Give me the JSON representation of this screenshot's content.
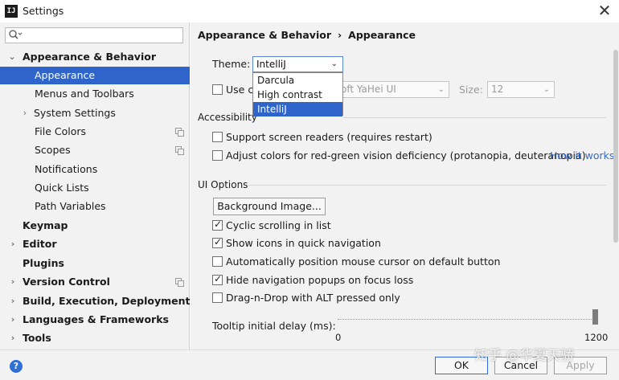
{
  "window": {
    "title": "Settings",
    "app_icon_text": "IJ",
    "close": "✕"
  },
  "search": {
    "placeholder": ""
  },
  "tree": [
    {
      "label": "Appearance & Behavior",
      "arrow": "⌄",
      "bold": true
    },
    {
      "label": "Appearance",
      "selected": true
    },
    {
      "label": "Menus and Toolbars"
    },
    {
      "label": "System Settings",
      "arrow": "›"
    },
    {
      "label": "File Colors",
      "copy_icon": true
    },
    {
      "label": "Scopes",
      "copy_icon": true
    },
    {
      "label": "Notifications"
    },
    {
      "label": "Quick Lists"
    },
    {
      "label": "Path Variables"
    },
    {
      "label": "Keymap",
      "bold": true
    },
    {
      "label": "Editor",
      "arrow": "›",
      "bold": true
    },
    {
      "label": "Plugins",
      "bold": true
    },
    {
      "label": "Version Control",
      "arrow": "›",
      "bold": true,
      "copy_icon": true
    },
    {
      "label": "Build, Execution, Deployment",
      "arrow": "›",
      "bold": true
    },
    {
      "label": "Languages & Frameworks",
      "arrow": "›",
      "bold": true
    },
    {
      "label": "Tools",
      "arrow": "›",
      "bold": true
    }
  ],
  "breadcrumb": {
    "parent": "Appearance & Behavior",
    "separator": "›",
    "current": "Appearance"
  },
  "theme": {
    "label": "Theme:",
    "value": "IntelliJ",
    "options": [
      "Darcula",
      "High contrast",
      "IntelliJ"
    ],
    "highlighted": "IntelliJ"
  },
  "custom_font": {
    "label": "Use cu",
    "font_value": "oft YaHei UI",
    "size_label": "Size:",
    "size_value": "12",
    "checked": false
  },
  "accessibility": {
    "title": "Accessibility",
    "screen_readers": "Support screen readers (requires restart)",
    "color_adjust": "Adjust colors for red-green vision deficiency (protanopia, deuteranopia)",
    "how_it_works": "How it works"
  },
  "ui_options": {
    "title": "UI Options",
    "background_button": "Background Image...",
    "options": [
      {
        "label": "Cyclic scrolling in list",
        "checked": true
      },
      {
        "label": "Show icons in quick navigation",
        "checked": true
      },
      {
        "label": "Automatically position mouse cursor on default button",
        "checked": false
      },
      {
        "label": "Hide navigation popups on focus loss",
        "checked": true
      },
      {
        "label": "Drag-n-Drop with ALT pressed only",
        "checked": false
      }
    ],
    "tooltip_label": "Tooltip initial delay (ms):",
    "tooltip_min": "0",
    "tooltip_max": "1200",
    "tooltip_value": 1200
  },
  "buttons": {
    "ok": "OK",
    "cancel": "Cancel",
    "apply": "Apply"
  },
  "help": "?",
  "watermark": "知乎 @华夏天骄",
  "colors": {
    "selection": "#2f65ca",
    "link": "#2f6bd3",
    "panel": "#f2f2f2"
  }
}
